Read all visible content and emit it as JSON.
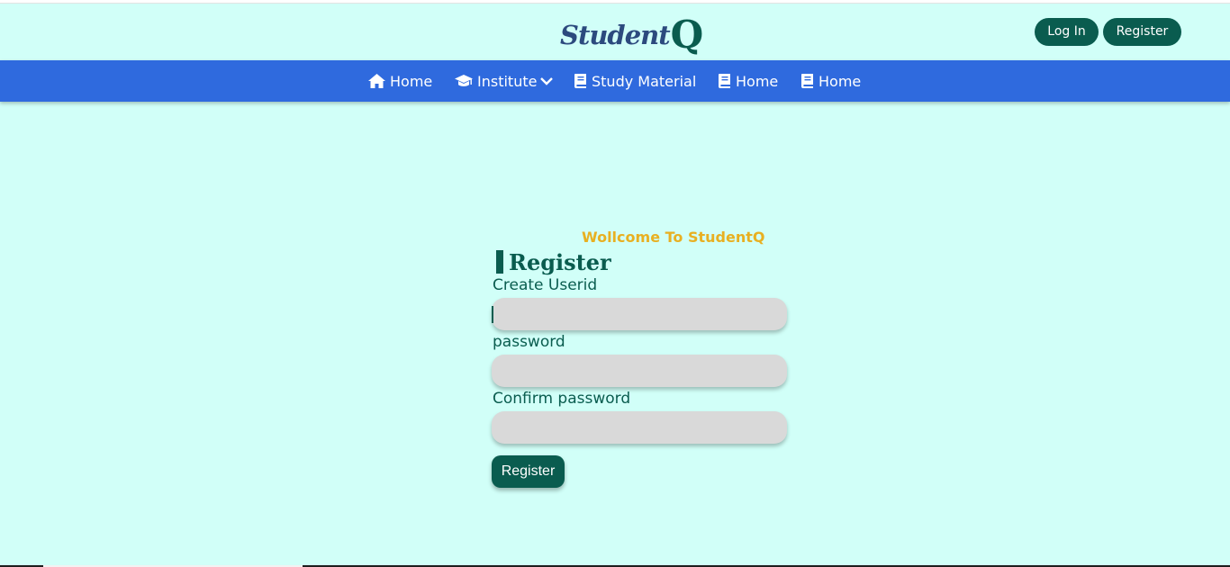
{
  "brand": {
    "name": "Student",
    "suffix": "Q"
  },
  "header": {
    "login_label": "Log In",
    "register_label": "Register"
  },
  "nav": [
    {
      "label": "Home",
      "icon": "home-icon"
    },
    {
      "label": "Institute",
      "icon": "graduation-cap-icon",
      "dropdown": true
    },
    {
      "label": "Study Material",
      "icon": "book-icon"
    },
    {
      "label": "Home",
      "icon": "book-icon"
    },
    {
      "label": "Home",
      "icon": "book-icon"
    }
  ],
  "form": {
    "welcome": "Wollcome To StudentQ",
    "title": "Register",
    "userid_label": "Create Userid",
    "userid_value": "",
    "password_label": "password",
    "password_value": "",
    "confirm_label": "Confirm password",
    "confirm_value": "",
    "submit_label": "Register"
  },
  "colors": {
    "background": "#d1fff8",
    "nav_bar": "#2f6ade",
    "primary": "#0a5c4f",
    "logo_blue": "#2c4a7e",
    "welcome_text": "#e8b022",
    "input_fill": "#d9d9d9"
  }
}
